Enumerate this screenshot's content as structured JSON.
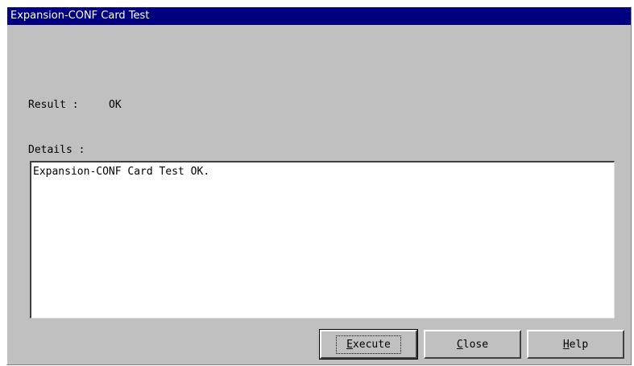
{
  "window": {
    "title": "Expansion-CONF Card Test"
  },
  "result": {
    "label": "Result :",
    "value": "OK"
  },
  "details": {
    "label": "Details :",
    "text": "Expansion-CONF Card Test OK."
  },
  "buttons": {
    "execute": {
      "mnemonic": "E",
      "rest": "xecute"
    },
    "close": {
      "mnemonic": "C",
      "rest": "lose"
    },
    "help": {
      "mnemonic": "H",
      "rest": "elp"
    }
  }
}
